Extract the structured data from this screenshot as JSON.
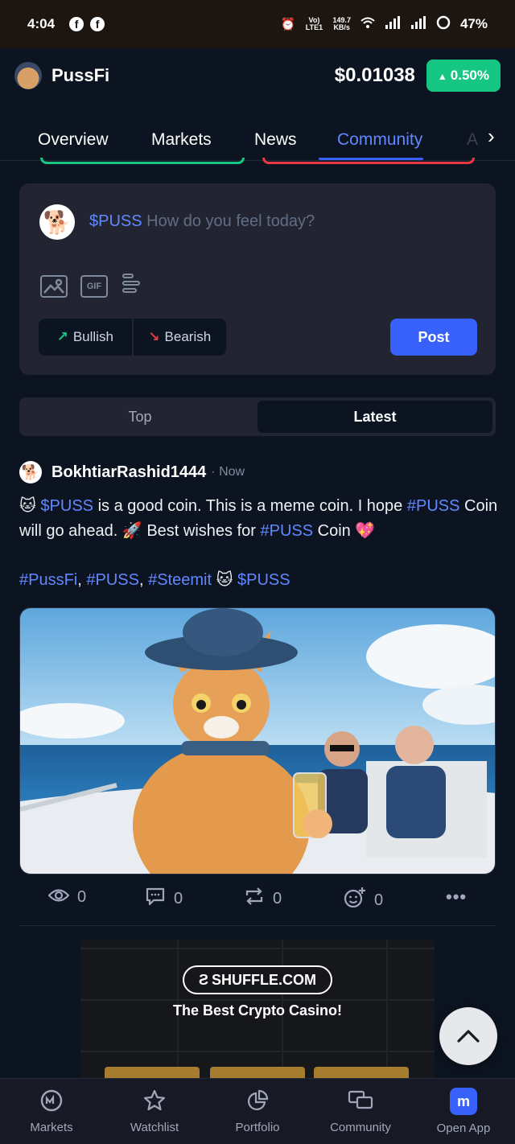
{
  "status_bar": {
    "time": "4:04",
    "battery": "47%",
    "speed_value": "149.7",
    "speed_unit": "KB/s",
    "net_label": "Vo) LTE1"
  },
  "header": {
    "coin_name": "PussFi",
    "price": "$0.01038",
    "change": "0.50%",
    "change_color": "#16c784"
  },
  "tabs": {
    "items": [
      "Overview",
      "Markets",
      "News",
      "Community"
    ],
    "active": "Community",
    "overflow_peek": "A"
  },
  "composer": {
    "ticker": "$PUSS",
    "placeholder": "How do you feel today?",
    "tools": [
      "image-icon",
      "gif-icon",
      "poll-icon"
    ],
    "gif_label": "GIF",
    "bullish_label": "Bullish",
    "bearish_label": "Bearish",
    "post_label": "Post"
  },
  "feed_toggle": {
    "top_label": "Top",
    "latest_label": "Latest",
    "active": "Latest"
  },
  "post": {
    "username": "BokhtiarRashid1444",
    "time": "Now",
    "body": {
      "ticker": "$PUSS",
      "text1": " is a good coin. This is a meme coin. I hope ",
      "tag1": "#PUSS",
      "text2": "Coin will go ahead. 🚀 Best wishes for ",
      "tag2": "#PUSS",
      "text3": " Coin 💖"
    },
    "tags": {
      "tag_a": "#PussFi",
      "tag_b": "#PUSS",
      "tag_c": "#Steemit",
      "ticker": "$PUSS"
    },
    "stats": {
      "views": "0",
      "comments": "0",
      "reposts": "0",
      "reactions": "0"
    }
  },
  "ad": {
    "brand": "SHUFFLE.COM",
    "tagline": "The Best Crypto Casino!"
  },
  "bottom_nav": {
    "items": [
      "Markets",
      "Watchlist",
      "Portfolio",
      "Community",
      "Open App"
    ]
  }
}
